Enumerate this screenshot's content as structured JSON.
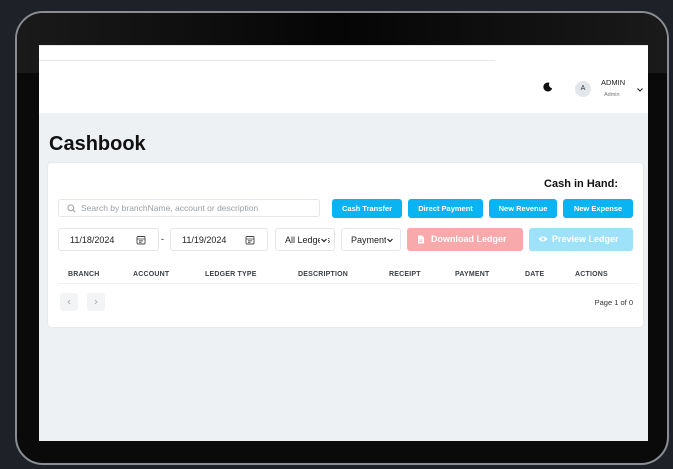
{
  "header": {
    "user_name": "ADMIN",
    "user_role": "Admin",
    "avatar_letter": "A"
  },
  "page": {
    "title": "Cashbook",
    "cash_in_hand_label": "Cash in Hand:"
  },
  "search": {
    "placeholder": "Search by branchName, account or description",
    "value": ""
  },
  "actions": {
    "cash_transfer": "Cash Transfer",
    "direct_payment": "Direct Payment",
    "new_revenue": "New Revenue",
    "new_expense": "New Expense"
  },
  "filters": {
    "start_date": "11/18/2024",
    "date_separator": "-",
    "end_date": "11/19/2024",
    "ledger_select": "All Ledgers",
    "payment_select": "Payment",
    "download_ledger": "Download Ledger",
    "preview_ledger": "Preview Ledger"
  },
  "table": {
    "columns": [
      "BRANCH",
      "ACCOUNT",
      "LEDGER TYPE",
      "DESCRIPTION",
      "RECEIPT",
      "PAYMENT",
      "DATE",
      "ACTIONS"
    ]
  },
  "pagination": {
    "page_info": "Page 1 of 0"
  },
  "colors": {
    "primary": "#0ab4f2",
    "download_disabled": "#f7a9ac",
    "preview_disabled": "#9ee2f9",
    "background": "#eef1f4"
  },
  "icons": [
    "moon-icon",
    "chevron-down-icon",
    "search-icon",
    "calendar-icon",
    "document-icon",
    "eye-icon",
    "chevron-left-icon",
    "chevron-right-icon"
  ]
}
